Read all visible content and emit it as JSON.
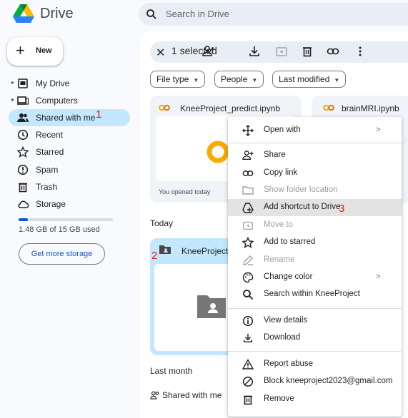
{
  "header": {
    "app_title": "Drive",
    "search_placeholder": "Search in Drive"
  },
  "sidebar": {
    "new_label": "New",
    "items": [
      {
        "label": "My Drive",
        "icon": "my-drive-icon"
      },
      {
        "label": "Computers",
        "icon": "computer-icon"
      },
      {
        "label": "Shared with me",
        "icon": "shared-icon",
        "active": true
      },
      {
        "label": "Recent",
        "icon": "clock-icon"
      },
      {
        "label": "Starred",
        "icon": "star-icon"
      },
      {
        "label": "Spam",
        "icon": "spam-icon"
      },
      {
        "label": "Trash",
        "icon": "trash-icon"
      },
      {
        "label": "Storage",
        "icon": "cloud-icon"
      }
    ],
    "storage_fraction": 0.1,
    "storage_text": "1.48 GB of 15 GB used",
    "get_more_storage": "Get more storage"
  },
  "selection_bar": {
    "count_label": "1 selected",
    "icons": [
      "add-person-icon",
      "download-icon",
      "move-to-folder-icon",
      "trash-icon",
      "link-icon",
      "more-vert-icon"
    ]
  },
  "filters": {
    "file_type": "File type",
    "people": "People",
    "last_modified": "Last modified"
  },
  "suggested": [
    {
      "title": "KneeProject_predict.ipynb",
      "subtitle": "You opened today"
    },
    {
      "title": "brainMRI.ipynb"
    }
  ],
  "sections": {
    "today": "Today",
    "last_month": "Last month"
  },
  "folder": {
    "name": "KneeProject"
  },
  "last_month_row": {
    "label": "Shared with me"
  },
  "context_menu": [
    {
      "label": "Open with",
      "icon": "open-with-icon",
      "submenu": true
    },
    {
      "label": "Share",
      "icon": "add-person-icon"
    },
    {
      "label": "Copy link",
      "icon": "link-icon"
    },
    {
      "label": "Show folder location",
      "icon": "folder-icon",
      "disabled": true
    },
    {
      "label": "Add shortcut to Drive",
      "icon": "add-shortcut-icon",
      "highlighted": true
    },
    {
      "label": "Move to",
      "icon": "move-to-icon",
      "disabled": true
    },
    {
      "label": "Add to starred",
      "icon": "star-icon"
    },
    {
      "label": "Rename",
      "icon": "pencil-icon",
      "disabled": true
    },
    {
      "label": "Change color",
      "icon": "palette-icon",
      "submenu": true
    },
    {
      "label": "Search within KneeProject",
      "icon": "search-icon"
    },
    {
      "label": "View details",
      "icon": "info-icon"
    },
    {
      "label": "Download",
      "icon": "download-icon"
    },
    {
      "label": "Report abuse",
      "icon": "warning-icon"
    },
    {
      "label": "Block kneeproject2023@gmail.com",
      "icon": "block-icon"
    },
    {
      "label": "Remove",
      "icon": "trash-icon"
    }
  ],
  "annotations": [
    "1",
    "2",
    "3"
  ],
  "colors": {
    "active_bg": "#c2e7ff",
    "accent": "#0b57d0",
    "annotation": "#e8191a",
    "highlight": "#e3e3e3"
  }
}
